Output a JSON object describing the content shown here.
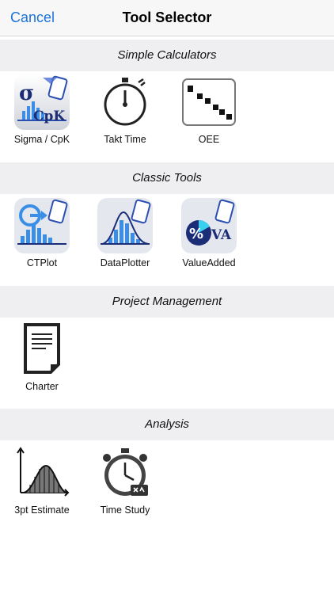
{
  "navbar": {
    "cancel_label": "Cancel",
    "title": "Tool Selector"
  },
  "sections": [
    {
      "title": "Simple Calculators",
      "tools": [
        {
          "label": "Sigma / CpK",
          "icon": "sigma-cpk-icon"
        },
        {
          "label": "Takt Time",
          "icon": "stopwatch-icon"
        },
        {
          "label": "OEE",
          "icon": "oee-dots-icon"
        }
      ]
    },
    {
      "title": "Classic Tools",
      "tools": [
        {
          "label": "CTPlot",
          "icon": "ctplot-icon"
        },
        {
          "label": "DataPlotter",
          "icon": "dataplotter-icon"
        },
        {
          "label": "ValueAdded",
          "icon": "valueadded-icon"
        }
      ]
    },
    {
      "title": "Project Management",
      "tools": [
        {
          "label": "Charter",
          "icon": "charter-document-icon"
        }
      ]
    },
    {
      "title": "Analysis",
      "tools": [
        {
          "label": "3pt Estimate",
          "icon": "distribution-curve-icon"
        },
        {
          "label": "Time Study",
          "icon": "time-study-stopwatch-icon"
        }
      ]
    }
  ],
  "badge_text": {
    "cpk_sigma": "σ",
    "cpk_label": "CpK",
    "va_percent": "%",
    "va_label": "VA"
  },
  "colors": {
    "accent": "#1a73d9",
    "section_bg": "#efeff2",
    "navbar_bg": "#f7f7f8",
    "icon_blue": "#2b5bd7"
  }
}
